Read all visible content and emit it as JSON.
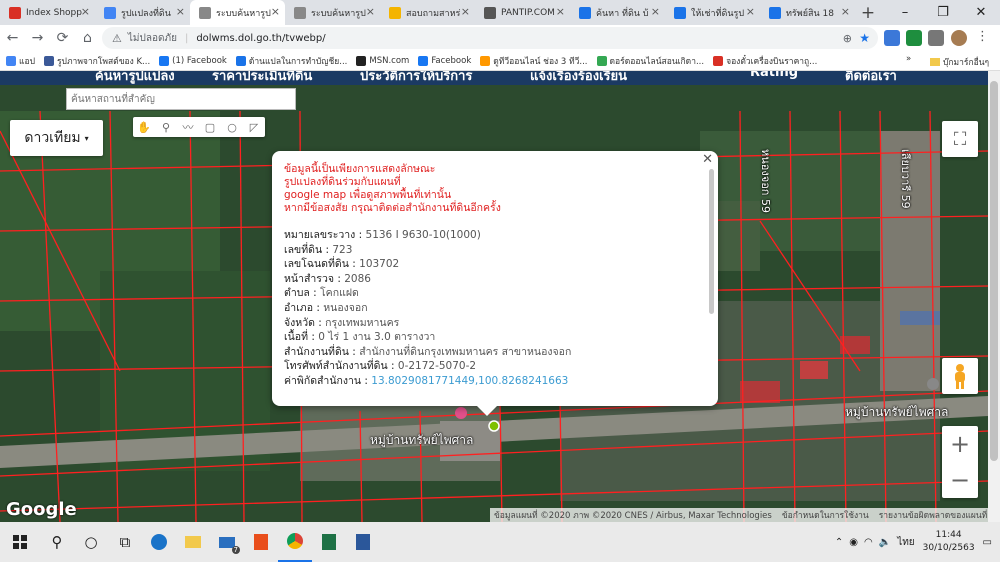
{
  "browser": {
    "tabs": [
      {
        "label": "Index Shopp",
        "color": "#d93025",
        "active": false
      },
      {
        "label": "รูปแปลงที่ดิน",
        "color": "#4285f4",
        "active": false
      },
      {
        "label": "ระบบค้นหารูป",
        "color": "#888888",
        "active": true
      },
      {
        "label": "ระบบค้นหารูป",
        "color": "#888888",
        "active": false
      },
      {
        "label": "สอบถามสาหร่",
        "color": "#f4b400",
        "active": false
      },
      {
        "label": "PANTIP.COM",
        "color": "#555555",
        "active": false
      },
      {
        "label": "ค้นหา ที่ดิน บ้",
        "color": "#1a73e8",
        "active": false
      },
      {
        "label": "ให้เช่าที่ดินรูป",
        "color": "#1a73e8",
        "active": false
      },
      {
        "label": "ทรัพย์สิน 18",
        "color": "#1a73e8",
        "active": false
      }
    ],
    "new_tab": "+",
    "window_controls": {
      "minimize": "–",
      "maximize": "❐",
      "close": "✕"
    },
    "nav": {
      "back": "←",
      "forward": "→",
      "reload": "⟳",
      "home": "⌂"
    },
    "address": {
      "security_label": "ไม่ปลอดภัย",
      "url": "dolwms.dol.go.th/tvwebp/"
    },
    "bookmarks": [
      {
        "label": "แอป",
        "color": "#4285f4"
      },
      {
        "label": "รูปภาพจากโพสต์ของ K...",
        "color": "#3b5998"
      },
      {
        "label": "(1) Facebook",
        "color": "#1877f2"
      },
      {
        "label": "ด้านแปลในการทำบัญชีย...",
        "color": "#1a73e8"
      },
      {
        "label": "MSN.com",
        "color": "#222222"
      },
      {
        "label": "Facebook",
        "color": "#1877f2"
      },
      {
        "label": "ดูทีวีออนไลน์ ช่อง 3 ทีวี...",
        "color": "#ff9800"
      },
      {
        "label": "ดอร์ดออนไลน์สอนเกิดา...",
        "color": "#34a853"
      },
      {
        "label": "จองตั๋วเครื่องบินราคาถู...",
        "color": "#d93025"
      }
    ],
    "bookmarks_more": "»",
    "other_bookmarks": "บุ๊กมาร์กอื่นๆ"
  },
  "page": {
    "topnav": [
      "ค้นหารูปแปลง",
      "ราคาประเมินที่ดิน",
      "ประวัติการให้บริการ",
      "แจ้งเรื่องร้องเรียน",
      "Rating",
      "ติดต่อเรา"
    ],
    "search_placeholder": "ค้นหาสถานที่สำคัญ",
    "map_type": "ดาวเทียม",
    "map_labels": [
      "หมู่บ้านทรัพย์ไพศาล",
      "หมู่บ้านทรัพย์ไพศาล",
      "หนองจอก 59",
      "เลียบวารี 59"
    ],
    "google": "Google",
    "attribution": [
      "ข้อมูลแผนที่ ©2020 ภาพ ©2020 CNES / Airbus, Maxar Technologies",
      "ข้อกำหนดในการใช้งาน",
      "รายงานข้อผิดพลาดของแผนที่"
    ]
  },
  "infowindow": {
    "disclaimer": [
      "ข้อมูลนี้เป็นเพียงการแสดงลักษณะ",
      "รูปแปลงที่ดินร่วมกับแผนที่",
      "google map เพื่อดูสภาพพื้นที่เท่านั้น",
      "หากมีข้อสงสัย กรุณาติดต่อสำนักงานที่ดินอีกครั้ง"
    ],
    "fields": [
      {
        "label": "หมายเลขระวาง",
        "value": "5136 I 9630-10(1000)"
      },
      {
        "label": "เลขที่ดิน",
        "value": "723"
      },
      {
        "label": "เลขโฉนดที่ดิน",
        "value": "103702"
      },
      {
        "label": "หน้าสำรวจ",
        "value": "2086"
      },
      {
        "label": "ตำบล",
        "value": "โคกแฝด"
      },
      {
        "label": "อำเภอ",
        "value": "หนองจอก"
      },
      {
        "label": "จังหวัด",
        "value": "กรุงเทพมหานคร"
      },
      {
        "label": "เนื้อที่",
        "value": "0 ไร่ 1 งาน 3.0 ตารางวา"
      },
      {
        "label": "สำนักงานที่ดิน",
        "value": "สำนักงานที่ดินกรุงเทพมหานคร สาขาหนองจอก"
      },
      {
        "label": "โทรศัพท์สำนักงานที่ดิน",
        "value": "0-2172-5070-2"
      },
      {
        "label": "ค่าพิกัดสำนักงาน",
        "value": "13.8029081771449,100.8268241663"
      }
    ],
    "separator": " : "
  },
  "taskbar": {
    "language": "ไทย",
    "time": "11:44",
    "date": "30/10/2563",
    "mail_badge": "7"
  }
}
